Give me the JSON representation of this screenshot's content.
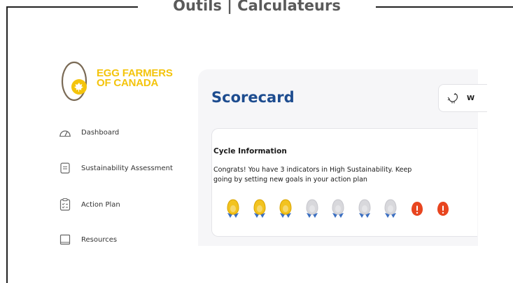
{
  "frame": {
    "title": "Outils | Calculateurs"
  },
  "logo": {
    "line1": "EGG FARMERS",
    "line2": "OF CANADA"
  },
  "sidebar": {
    "items": [
      {
        "label": "Dashboard",
        "icon": "gauge-icon"
      },
      {
        "label": "Sustainability Assessment",
        "icon": "form-icon"
      },
      {
        "label": "Action Plan",
        "icon": "checklist-icon"
      },
      {
        "label": "Resources",
        "icon": "book-icon"
      }
    ]
  },
  "header": {
    "title": "Scorecard",
    "button_label": "W"
  },
  "cycle": {
    "title": "Cycle Information",
    "message_line1": "Congrats! You have 3 indicators in High Sustainability. Keep",
    "message_line2": "going by setting new goals in your action plan",
    "indicators": [
      "high",
      "high",
      "high",
      "neutral",
      "neutral",
      "neutral",
      "neutral",
      "alert",
      "alert"
    ]
  },
  "colors": {
    "accent": "#1d4c8f",
    "brand_yellow": "#f4c40c",
    "medal_gold": "#f2c320",
    "medal_neutral": "#d8d8dc",
    "ribbon_blue": "#3b6fc2",
    "alert_red": "#e8451f"
  }
}
